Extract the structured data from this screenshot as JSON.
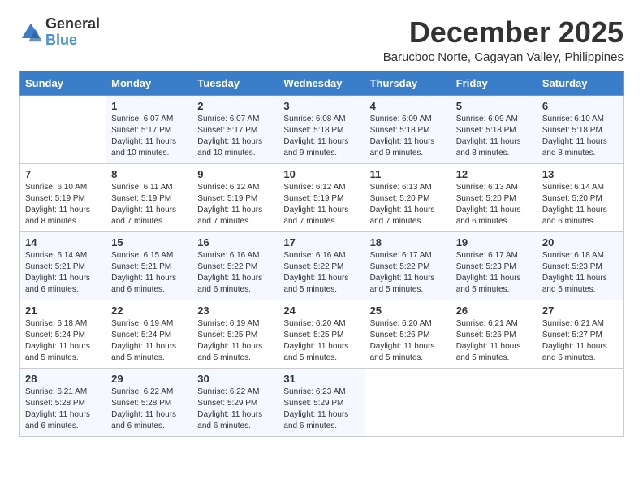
{
  "logo": {
    "general": "General",
    "blue": "Blue"
  },
  "title": "December 2025",
  "location": "Barucboc Norte, Cagayan Valley, Philippines",
  "days_of_week": [
    "Sunday",
    "Monday",
    "Tuesday",
    "Wednesday",
    "Thursday",
    "Friday",
    "Saturday"
  ],
  "weeks": [
    [
      {
        "day": "",
        "info": ""
      },
      {
        "day": "1",
        "info": "Sunrise: 6:07 AM\nSunset: 5:17 PM\nDaylight: 11 hours and 10 minutes."
      },
      {
        "day": "2",
        "info": "Sunrise: 6:07 AM\nSunset: 5:17 PM\nDaylight: 11 hours and 10 minutes."
      },
      {
        "day": "3",
        "info": "Sunrise: 6:08 AM\nSunset: 5:18 PM\nDaylight: 11 hours and 9 minutes."
      },
      {
        "day": "4",
        "info": "Sunrise: 6:09 AM\nSunset: 5:18 PM\nDaylight: 11 hours and 9 minutes."
      },
      {
        "day": "5",
        "info": "Sunrise: 6:09 AM\nSunset: 5:18 PM\nDaylight: 11 hours and 8 minutes."
      },
      {
        "day": "6",
        "info": "Sunrise: 6:10 AM\nSunset: 5:18 PM\nDaylight: 11 hours and 8 minutes."
      }
    ],
    [
      {
        "day": "7",
        "info": "Sunrise: 6:10 AM\nSunset: 5:19 PM\nDaylight: 11 hours and 8 minutes."
      },
      {
        "day": "8",
        "info": "Sunrise: 6:11 AM\nSunset: 5:19 PM\nDaylight: 11 hours and 7 minutes."
      },
      {
        "day": "9",
        "info": "Sunrise: 6:12 AM\nSunset: 5:19 PM\nDaylight: 11 hours and 7 minutes."
      },
      {
        "day": "10",
        "info": "Sunrise: 6:12 AM\nSunset: 5:19 PM\nDaylight: 11 hours and 7 minutes."
      },
      {
        "day": "11",
        "info": "Sunrise: 6:13 AM\nSunset: 5:20 PM\nDaylight: 11 hours and 7 minutes."
      },
      {
        "day": "12",
        "info": "Sunrise: 6:13 AM\nSunset: 5:20 PM\nDaylight: 11 hours and 6 minutes."
      },
      {
        "day": "13",
        "info": "Sunrise: 6:14 AM\nSunset: 5:20 PM\nDaylight: 11 hours and 6 minutes."
      }
    ],
    [
      {
        "day": "14",
        "info": "Sunrise: 6:14 AM\nSunset: 5:21 PM\nDaylight: 11 hours and 6 minutes."
      },
      {
        "day": "15",
        "info": "Sunrise: 6:15 AM\nSunset: 5:21 PM\nDaylight: 11 hours and 6 minutes."
      },
      {
        "day": "16",
        "info": "Sunrise: 6:16 AM\nSunset: 5:22 PM\nDaylight: 11 hours and 6 minutes."
      },
      {
        "day": "17",
        "info": "Sunrise: 6:16 AM\nSunset: 5:22 PM\nDaylight: 11 hours and 5 minutes."
      },
      {
        "day": "18",
        "info": "Sunrise: 6:17 AM\nSunset: 5:22 PM\nDaylight: 11 hours and 5 minutes."
      },
      {
        "day": "19",
        "info": "Sunrise: 6:17 AM\nSunset: 5:23 PM\nDaylight: 11 hours and 5 minutes."
      },
      {
        "day": "20",
        "info": "Sunrise: 6:18 AM\nSunset: 5:23 PM\nDaylight: 11 hours and 5 minutes."
      }
    ],
    [
      {
        "day": "21",
        "info": "Sunrise: 6:18 AM\nSunset: 5:24 PM\nDaylight: 11 hours and 5 minutes."
      },
      {
        "day": "22",
        "info": "Sunrise: 6:19 AM\nSunset: 5:24 PM\nDaylight: 11 hours and 5 minutes."
      },
      {
        "day": "23",
        "info": "Sunrise: 6:19 AM\nSunset: 5:25 PM\nDaylight: 11 hours and 5 minutes."
      },
      {
        "day": "24",
        "info": "Sunrise: 6:20 AM\nSunset: 5:25 PM\nDaylight: 11 hours and 5 minutes."
      },
      {
        "day": "25",
        "info": "Sunrise: 6:20 AM\nSunset: 5:26 PM\nDaylight: 11 hours and 5 minutes."
      },
      {
        "day": "26",
        "info": "Sunrise: 6:21 AM\nSunset: 5:26 PM\nDaylight: 11 hours and 5 minutes."
      },
      {
        "day": "27",
        "info": "Sunrise: 6:21 AM\nSunset: 5:27 PM\nDaylight: 11 hours and 6 minutes."
      }
    ],
    [
      {
        "day": "28",
        "info": "Sunrise: 6:21 AM\nSunset: 5:28 PM\nDaylight: 11 hours and 6 minutes."
      },
      {
        "day": "29",
        "info": "Sunrise: 6:22 AM\nSunset: 5:28 PM\nDaylight: 11 hours and 6 minutes."
      },
      {
        "day": "30",
        "info": "Sunrise: 6:22 AM\nSunset: 5:29 PM\nDaylight: 11 hours and 6 minutes."
      },
      {
        "day": "31",
        "info": "Sunrise: 6:23 AM\nSunset: 5:29 PM\nDaylight: 11 hours and 6 minutes."
      },
      {
        "day": "",
        "info": ""
      },
      {
        "day": "",
        "info": ""
      },
      {
        "day": "",
        "info": ""
      }
    ]
  ]
}
